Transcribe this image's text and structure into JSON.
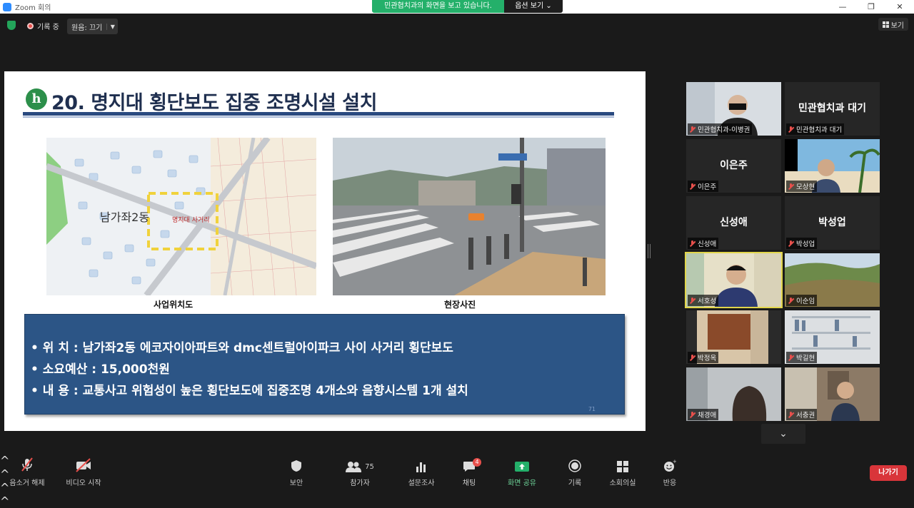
{
  "window": {
    "title": "Zoom 회의",
    "minimize": "—",
    "maximize": "❐",
    "close": "✕"
  },
  "share_banner": {
    "message": "민관협치과의 화면을 보고 있습니다.",
    "options": "옵션 보기 ⌄"
  },
  "status": {
    "recording": "기록 중",
    "audio_label": "원음: 끄기",
    "view_label": "보기"
  },
  "slide": {
    "logo_letter": "h",
    "title": "20. 명지대 횡단보도 집중 조명시설 설치",
    "map_label_area": "남가좌2동",
    "map_label_site": "명지대 사거리",
    "caption_map": "사업위치도",
    "caption_photo": "현장사진",
    "lines": [
      "• 위      치 : 남가좌2동 에코자이아파트와 dmc센트럴아이파크 사이 사거리 횡단보도",
      "• 소요예산 : 15,000천원",
      "• 내      용 : 교통사고 위험성이 높은 횡단보도에 집중조명 4개소와 음향시스템 1개 설치"
    ],
    "page_number": "71"
  },
  "gallery": [
    {
      "name": "민관협치과-이병권",
      "big": "",
      "video": true,
      "scene": "person1"
    },
    {
      "name": "민관협치과 대기",
      "big": "민관협치과 대기",
      "video": false
    },
    {
      "name": "이은주",
      "big": "이은주",
      "video": false
    },
    {
      "name": "모상현",
      "big": "",
      "video": true,
      "scene": "beach"
    },
    {
      "name": "신성애",
      "big": "신성애",
      "video": false
    },
    {
      "name": "박성업",
      "big": "박성업",
      "video": false
    },
    {
      "name": "서호성",
      "big": "",
      "video": true,
      "scene": "person2",
      "active": true
    },
    {
      "name": "이순임",
      "big": "",
      "video": true,
      "scene": "hill"
    },
    {
      "name": "박정옥",
      "big": "",
      "video": true,
      "scene": "room"
    },
    {
      "name": "박길현",
      "big": "",
      "video": true,
      "scene": "shelf"
    },
    {
      "name": "채경애",
      "big": "",
      "video": true,
      "scene": "person3"
    },
    {
      "name": "서충권",
      "big": "",
      "video": true,
      "scene": "person4"
    }
  ],
  "more_label": "⌄",
  "toolbar": {
    "mute": "음소거 해제",
    "video": "비디오 시작",
    "security": "보안",
    "participants": "참가자",
    "participant_count": "75",
    "polls": "설문조사",
    "chat": "채팅",
    "chat_badge": "4",
    "share": "화면 공유",
    "record": "기록",
    "breakout": "소회의실",
    "reactions": "반응",
    "leave": "나가기"
  }
}
